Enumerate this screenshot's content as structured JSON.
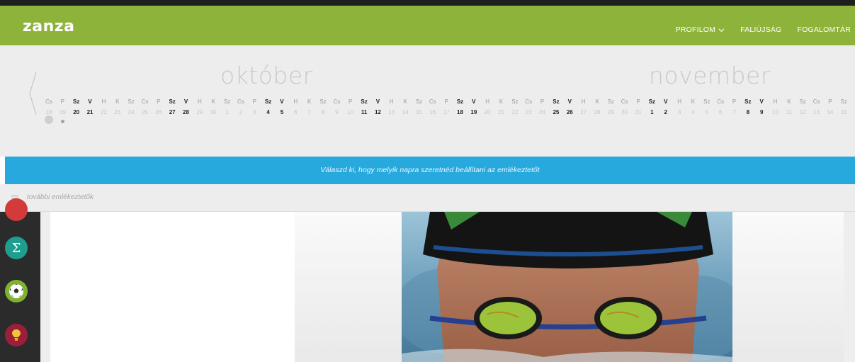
{
  "header": {
    "logo": "zanza",
    "nav": [
      {
        "label": "PROFILOM",
        "has_dropdown": true
      },
      {
        "label": "FALIÚJSÁG",
        "has_dropdown": false
      },
      {
        "label": "FOGALOMTÁR",
        "has_dropdown": false
      }
    ]
  },
  "calendar": {
    "months": [
      "október",
      "november"
    ],
    "weekdays": [
      "Cs",
      "P",
      "Sz",
      "V",
      "H",
      "K",
      "Sz",
      "Cs",
      "P",
      "Sz",
      "V",
      "H",
      "K",
      "Sz",
      "Cs",
      "P",
      "Sz",
      "V",
      "H",
      "K",
      "Sz",
      "Cs",
      "P",
      "Sz",
      "V",
      "H",
      "K",
      "Sz",
      "Cs",
      "P",
      "Sz",
      "V",
      "H",
      "K",
      "Sz",
      "Cs",
      "P",
      "Sz",
      "V",
      "H",
      "K",
      "Sz",
      "Cs",
      "P",
      "Sz",
      "V",
      "H",
      "K",
      "Sz",
      "Cs",
      "P",
      "Sz",
      "V",
      "H",
      "K",
      "Sz",
      "Cs",
      "P",
      "Sz"
    ],
    "dates": [
      "18",
      "19",
      "20",
      "21",
      "22",
      "23",
      "24",
      "25",
      "26",
      "27",
      "28",
      "29",
      "30",
      "1",
      "2",
      "3",
      "4",
      "5",
      "6",
      "7",
      "8",
      "9",
      "10",
      "11",
      "12",
      "13",
      "14",
      "15",
      "16",
      "17",
      "18",
      "19",
      "20",
      "21",
      "22",
      "23",
      "24",
      "25",
      "26",
      "27",
      "28",
      "29",
      "30",
      "31",
      "1",
      "2",
      "3",
      "4",
      "5",
      "6",
      "7",
      "8",
      "9",
      "10",
      "11",
      "12",
      "13",
      "14",
      "15"
    ],
    "selected_date": "18"
  },
  "banner": {
    "text": "Válaszd ki, hogy melyik napra szeretnéd beállítani az emlékeztetőt"
  },
  "reminders": {
    "label": "további emlékeztetők"
  },
  "colors": {
    "header": "#8db33a",
    "banner": "#27a9de",
    "sidebar": "#2b2b2b"
  }
}
